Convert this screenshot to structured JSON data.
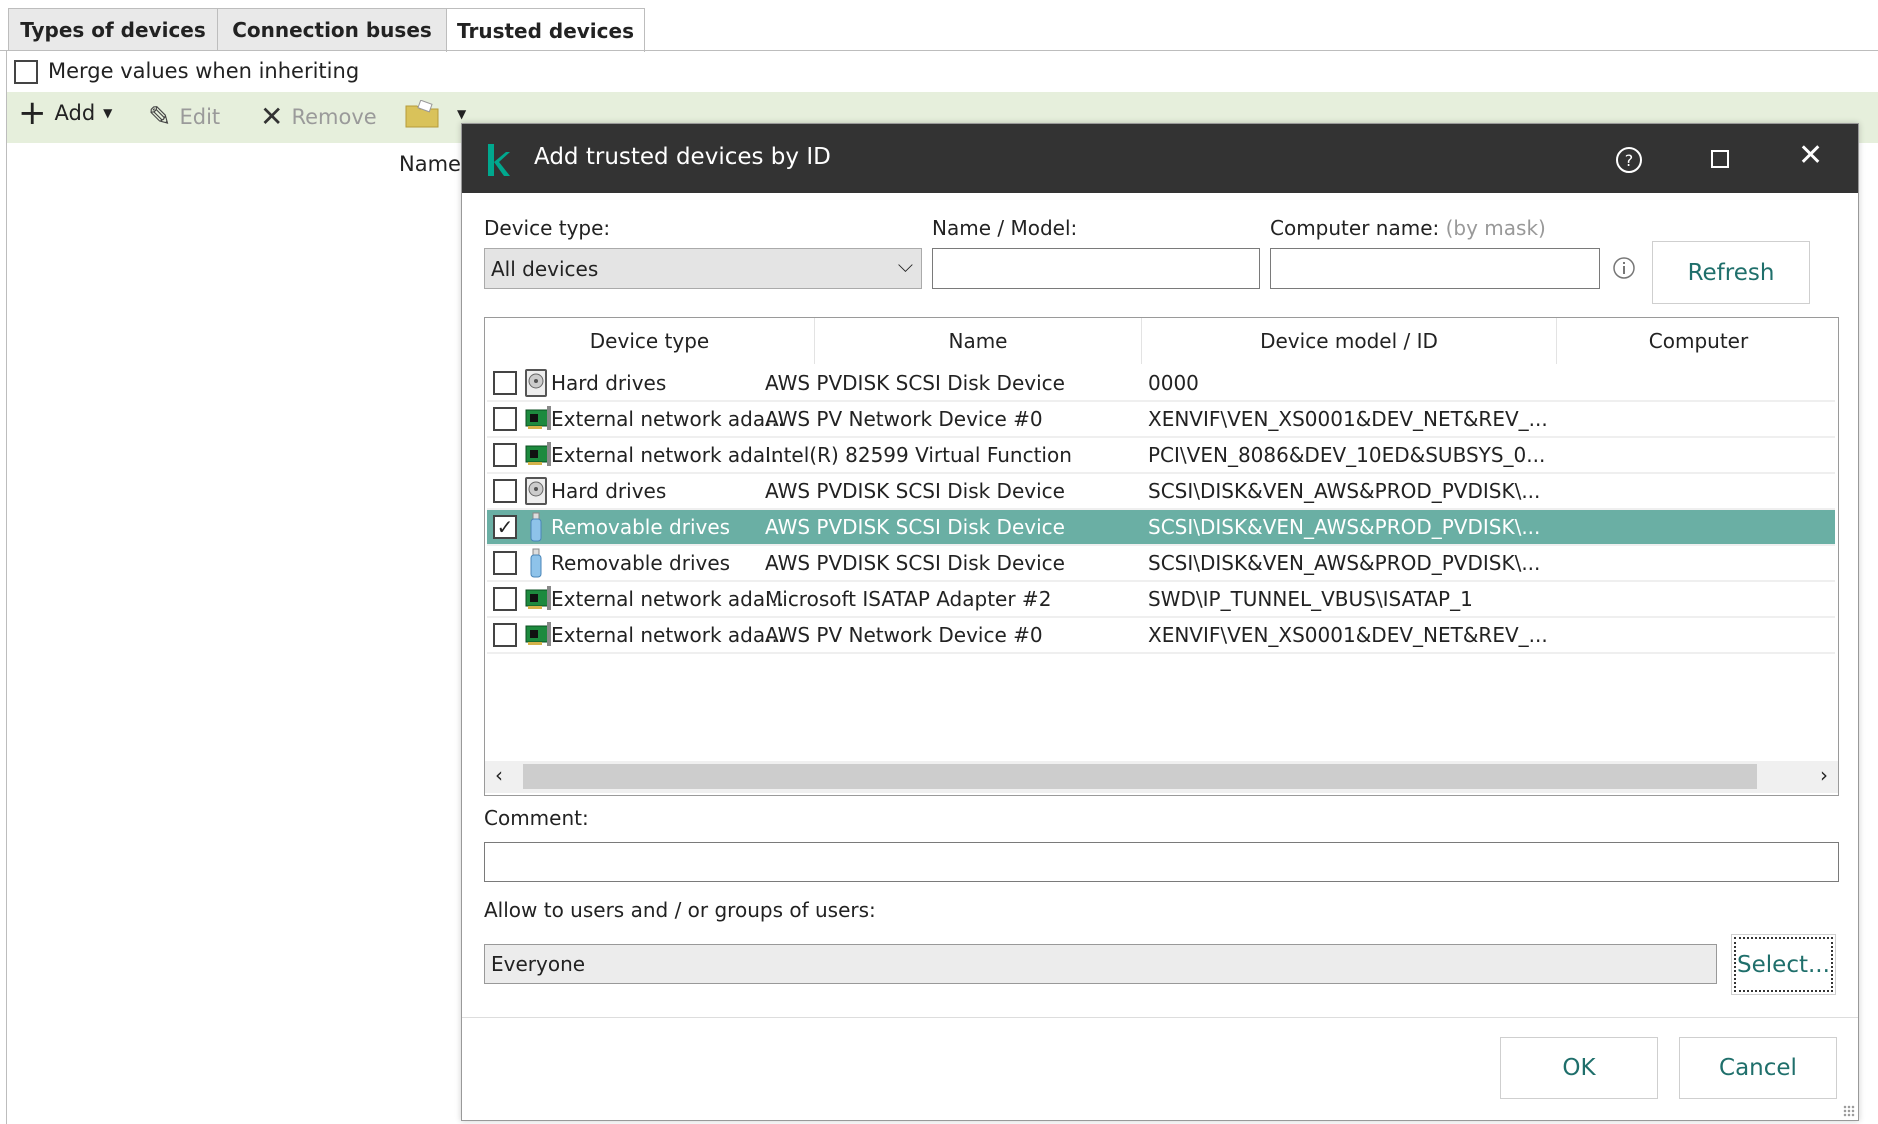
{
  "tabs": [
    {
      "label": "Types of devices"
    },
    {
      "label": "Connection buses"
    },
    {
      "label": "Trusted devices",
      "active": true
    }
  ],
  "merge_label": "Merge values when inheriting",
  "toolbar": {
    "add": "Add",
    "edit": "Edit",
    "remove": "Remove"
  },
  "list_header": {
    "name": "Name"
  },
  "dialog": {
    "title": "Add trusted devices by ID",
    "device_type_label": "Device type:",
    "device_type_value": "All devices",
    "name_model_label": "Name / Model:",
    "name_model_value": "",
    "computer_name_label": "Computer name:",
    "computer_name_hint": "(by mask)",
    "computer_name_value": "",
    "refresh": "Refresh",
    "columns": [
      "Device type",
      "Name",
      "Device model / ID",
      "Computer"
    ],
    "rows": [
      {
        "checked": false,
        "icon": "hard-drive-icon",
        "type": "Hard drives",
        "name": "AWS PVDISK SCSI Disk Device",
        "id": "0000",
        "computer": ""
      },
      {
        "checked": false,
        "icon": "network-adapter-icon",
        "type": "External network ada...",
        "name": "AWS PV Network Device #0",
        "id": "XENVIF\\VEN_XS0001&DEV_NET&REV_...",
        "computer": ""
      },
      {
        "checked": false,
        "icon": "network-adapter-icon",
        "type": "External network ada...",
        "name": "Intel(R) 82599 Virtual Function",
        "id": "PCI\\VEN_8086&DEV_10ED&SUBSYS_0...",
        "computer": ""
      },
      {
        "checked": false,
        "icon": "hard-drive-icon",
        "type": "Hard drives",
        "name": "AWS PVDISK SCSI Disk Device",
        "id": "SCSI\\DISK&VEN_AWS&PROD_PVDISK\\...",
        "computer": ""
      },
      {
        "checked": true,
        "selected": true,
        "icon": "usb-drive-icon",
        "type": "Removable drives",
        "name": "AWS PVDISK SCSI Disk Device",
        "id": "SCSI\\DISK&VEN_AWS&PROD_PVDISK\\...",
        "computer": ""
      },
      {
        "checked": false,
        "icon": "usb-drive-icon",
        "type": "Removable drives",
        "name": "AWS PVDISK SCSI Disk Device",
        "id": "SCSI\\DISK&VEN_AWS&PROD_PVDISK\\...",
        "computer": ""
      },
      {
        "checked": false,
        "icon": "network-adapter-icon",
        "type": "External network ada...",
        "name": "Microsoft ISATAP Adapter #2",
        "id": "SWD\\IP_TUNNEL_VBUS\\ISATAP_1",
        "computer": ""
      },
      {
        "checked": false,
        "icon": "network-adapter-icon",
        "type": "External network ada...",
        "name": "AWS PV Network Device #0",
        "id": "XENVIF\\VEN_XS0001&DEV_NET&REV_...",
        "computer": ""
      }
    ],
    "comment_label": "Comment:",
    "comment_value": "",
    "allow_label": "Allow to users and / or groups of users:",
    "allow_value": "Everyone",
    "select": "Select...",
    "ok": "OK",
    "cancel": "Cancel"
  },
  "colors": {
    "accent": "#00a88e",
    "titlebar": "#333333",
    "selected_row": "#6aafa4",
    "toolbar_bg": "#e6efdc",
    "button_text": "#1f6f6b"
  }
}
